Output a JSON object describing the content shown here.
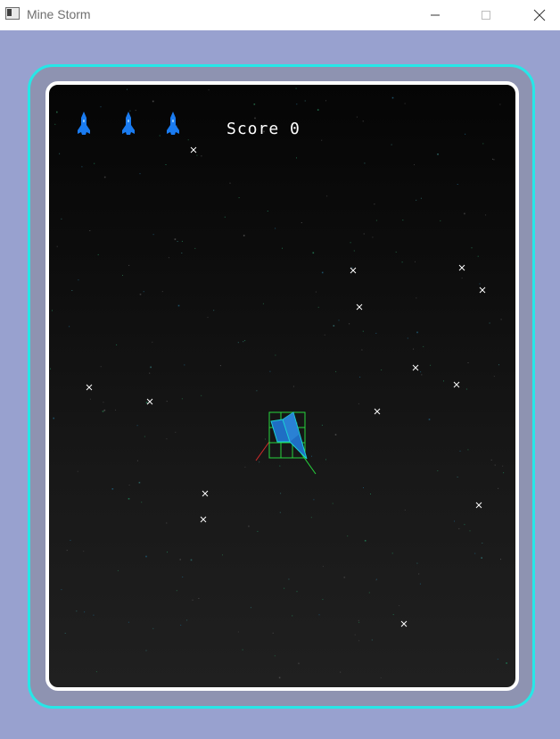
{
  "window": {
    "title": "Mine Storm",
    "controls": [
      "minimize",
      "maximize",
      "close"
    ]
  },
  "hud": {
    "score_label": "Score",
    "score_value": "0",
    "lives": 3,
    "life_icon": "ship-icon",
    "life_color": "#1a7bf0"
  },
  "colors": {
    "background": "#98a1cf",
    "outer_border": "#26e7e7",
    "inner_border": "#ffffff",
    "mine_marker": "#ffffff",
    "ship_fill": "#1f6ec4",
    "ship_outline": "#19d3d3",
    "hitbox": "#27d63d",
    "thrust_line": "#d12a2a"
  },
  "entities": {
    "player": {
      "icon": "player-ship-icon",
      "debug_hitbox": true
    },
    "mine_markers": 15
  }
}
